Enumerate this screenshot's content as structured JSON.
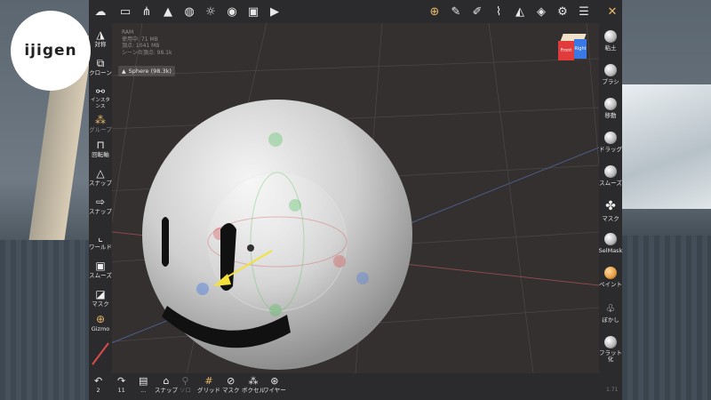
{
  "logo": {
    "text": "ijigen"
  },
  "top_toolbar": {
    "icons": [
      "menu-icon",
      "folder-icon",
      "scene-graph-icon",
      "mesh-icon",
      "globe-icon",
      "sun-icon",
      "material-icon",
      "image-icon",
      "video-icon",
      "gizmo-icon",
      "pen-icon",
      "picker-icon",
      "paint-icon",
      "triangle-icon",
      "layers-icon",
      "settings-icon",
      "sliders-icon",
      "tools-icon"
    ]
  },
  "left_toolbar": {
    "items": [
      {
        "label": "対称",
        "icon": "symmetry-icon"
      },
      {
        "label": "クローン",
        "icon": "clone-icon"
      },
      {
        "label": "インスタンス",
        "icon": "instance-icon"
      },
      {
        "label": "グループ",
        "icon": "group-icon",
        "dim": true
      },
      {
        "label": "回転軸",
        "icon": "lock-icon"
      },
      {
        "label": "スナップ",
        "icon": "snap-icon"
      },
      {
        "label": "スナップ",
        "icon": "arrow-right-icon"
      },
      {
        "label": "ワールド",
        "icon": "world-icon"
      },
      {
        "label": "スムーズ",
        "icon": "smooth-icon"
      },
      {
        "label": "マスク",
        "icon": "mask-icon"
      },
      {
        "label": "Gizmo",
        "icon": "gizmo-icon"
      }
    ]
  },
  "right_toolbar": {
    "items": [
      {
        "label": "粘土",
        "icon": "clay-icon"
      },
      {
        "label": "ブラシ",
        "icon": "brush-icon"
      },
      {
        "label": "移動",
        "icon": "move-icon"
      },
      {
        "label": "ドラッグ",
        "icon": "drag-icon"
      },
      {
        "label": "スムーズ",
        "icon": "smooth-brush-icon"
      },
      {
        "label": "マスク",
        "icon": "mask-brush-icon"
      },
      {
        "label": "SelMask",
        "icon": "selmask-icon"
      },
      {
        "label": "ペイント",
        "icon": "paint-brush-icon"
      },
      {
        "label": "ぼかし",
        "icon": "blur-icon"
      },
      {
        "label": "フラット化",
        "icon": "flatten-icon"
      }
    ]
  },
  "bottom_toolbar": {
    "undo": {
      "label": "2"
    },
    "redo": {
      "label": "11"
    },
    "items": [
      {
        "label": "...",
        "icon": "save-icon"
      },
      {
        "label": "スナップ",
        "icon": "camera-icon"
      },
      {
        "label": "ソロ",
        "icon": "solo-icon",
        "dim": true
      },
      {
        "label": "グリッド",
        "icon": "grid-icon"
      },
      {
        "label": "マスク",
        "icon": "mask-eye-icon"
      },
      {
        "label": "ボクセル",
        "icon": "voxel-icon"
      },
      {
        "label": "ワイヤー",
        "icon": "wire-icon"
      }
    ]
  },
  "stats": {
    "lines": [
      "RAM",
      "使用中: 71 MB",
      "頂点: 1041 MB",
      "シーンの頂点: 98.1k"
    ]
  },
  "object": {
    "name": "Sphere (98.3k)"
  },
  "view_cube": {
    "front": "Front",
    "side": "Right"
  },
  "version": {
    "text": "1.71"
  },
  "colors": {
    "accent": "#e8b96a",
    "arrow": "#f3e23a",
    "gizmo_red": "#d84b4b",
    "gizmo_green": "#4fbf5a",
    "gizmo_blue": "#4a7de0"
  }
}
